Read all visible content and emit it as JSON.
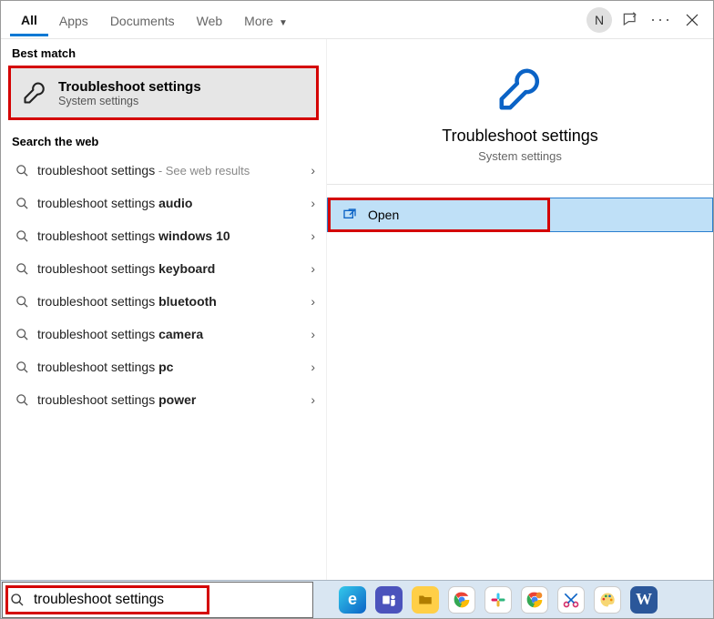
{
  "tabs": {
    "items": [
      "All",
      "Apps",
      "Documents",
      "Web",
      "More"
    ],
    "active_index": 0,
    "avatar_letter": "N"
  },
  "left": {
    "best_match_header": "Best match",
    "best_match": {
      "title": "Troubleshoot settings",
      "subtitle": "System settings"
    },
    "search_web_header": "Search the web",
    "web": [
      {
        "prefix": "troubleshoot settings",
        "bold": "",
        "aux": " - See web results"
      },
      {
        "prefix": "troubleshoot settings ",
        "bold": "audio",
        "aux": ""
      },
      {
        "prefix": "troubleshoot settings ",
        "bold": "windows 10",
        "aux": ""
      },
      {
        "prefix": "troubleshoot settings ",
        "bold": "keyboard",
        "aux": ""
      },
      {
        "prefix": "troubleshoot settings ",
        "bold": "bluetooth",
        "aux": ""
      },
      {
        "prefix": "troubleshoot settings ",
        "bold": "camera",
        "aux": ""
      },
      {
        "prefix": "troubleshoot settings ",
        "bold": "pc",
        "aux": ""
      },
      {
        "prefix": "troubleshoot settings ",
        "bold": "power",
        "aux": ""
      }
    ]
  },
  "right": {
    "title": "Troubleshoot settings",
    "subtitle": "System settings",
    "action": "Open"
  },
  "search": {
    "value": "troubleshoot settings"
  },
  "task_icons": [
    "edge",
    "teams",
    "explorer",
    "chrome",
    "slack",
    "chrome2",
    "snip",
    "paint",
    "word"
  ]
}
